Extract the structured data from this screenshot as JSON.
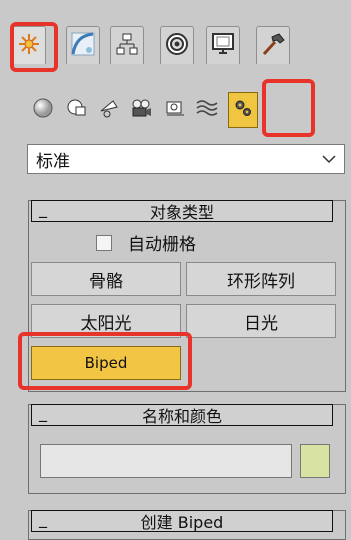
{
  "main_tabs": [
    {
      "name": "create",
      "icon": "create-sun-icon",
      "active": true
    },
    {
      "name": "modify",
      "icon": "modify-curve-icon",
      "active": false
    },
    {
      "name": "hierarchy",
      "icon": "hierarchy-icon",
      "active": false
    },
    {
      "name": "motion",
      "icon": "motion-icon",
      "active": false
    },
    {
      "name": "display",
      "icon": "display-monitor-icon",
      "active": false
    },
    {
      "name": "utilities",
      "icon": "utilities-hammer-icon",
      "active": false
    }
  ],
  "sub_categories": [
    {
      "name": "geometry",
      "icon": "sphere-icon"
    },
    {
      "name": "shapes",
      "icon": "shapes-icon"
    },
    {
      "name": "lights",
      "icon": "light-icon"
    },
    {
      "name": "cameras",
      "icon": "camera-icon"
    },
    {
      "name": "helpers",
      "icon": "helpers-icon"
    },
    {
      "name": "space-warps",
      "icon": "space-warp-icon"
    },
    {
      "name": "systems",
      "icon": "systems-gears-icon",
      "active": true
    }
  ],
  "dropdown": {
    "selected": "标准"
  },
  "object_type": {
    "title": "对象类型",
    "collapse_symbol": "_",
    "autogrid_label": "自动栅格",
    "buttons": {
      "bones": "骨骼",
      "ring_array": "环形阵列",
      "sunlight": "太阳光",
      "daylight": "日光",
      "biped": "Biped"
    }
  },
  "name_color": {
    "title": "名称和颜色",
    "collapse_symbol": "_",
    "name_value": "",
    "swatch_color": "#d8e3a3"
  },
  "create_biped": {
    "title": "创建 Biped",
    "collapse_symbol": "_"
  },
  "colors": {
    "highlight": "#e8332a",
    "active_yellow": "#f2c545"
  }
}
